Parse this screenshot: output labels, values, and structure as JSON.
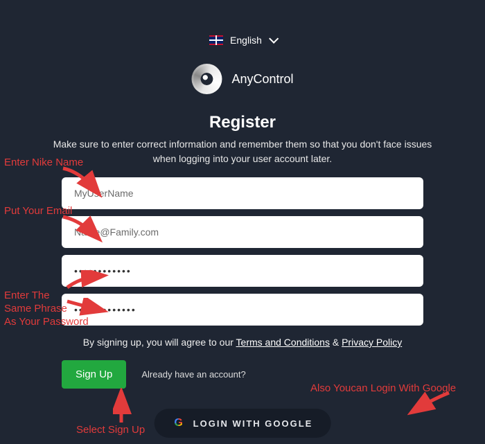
{
  "language": {
    "label": "English"
  },
  "brand": {
    "name": "AnyControl"
  },
  "page": {
    "title": "Register",
    "subtitle": "Make sure to enter correct information and remember them so that you don't face issues when logging into your user account later."
  },
  "form": {
    "username": "MyUserName",
    "email": "Name@Family.com",
    "password": "••••••••••••",
    "confirm": "•••••••••••••"
  },
  "agreement": {
    "prefix": "By signing up, you will agree to our ",
    "terms": "Terms and Conditions",
    "amp": " & ",
    "privacy": "Privacy Policy"
  },
  "actions": {
    "signup": "Sign Up",
    "already": "Already have an account?",
    "google": "LOGIN WITH GOOGLE"
  },
  "annotations": {
    "username": "Enter Nike Name",
    "email": "Put Your Email",
    "password": "Enter The\nSame Phrase\nAs Your Password",
    "signup": "Select Sign Up",
    "google": "Also Youcan Login With Google"
  }
}
